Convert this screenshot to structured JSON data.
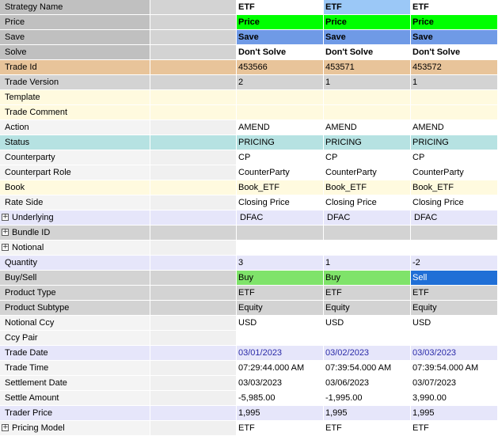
{
  "grid": {
    "rows": [
      {
        "label": "Strategy Name",
        "values": [
          "ETF",
          "ETF",
          "ETF"
        ],
        "style": "strategy"
      },
      {
        "label": "Price",
        "values": [
          "Price",
          "Price",
          "Price"
        ],
        "style": "price"
      },
      {
        "label": "Save",
        "values": [
          "Save",
          "Save",
          "Save"
        ],
        "style": "save"
      },
      {
        "label": "Solve",
        "values": [
          "Don't Solve",
          "Don't Solve",
          "Don't Solve"
        ],
        "style": "solve"
      },
      {
        "label": "Trade Id",
        "values": [
          "453566",
          "453571",
          "453572"
        ],
        "style": "tradeid"
      },
      {
        "label": "Trade Version",
        "values": [
          "2",
          "1",
          "1"
        ],
        "style": "version"
      },
      {
        "label": "Template",
        "values": [
          "",
          "",
          ""
        ],
        "style": "cream"
      },
      {
        "label": "Trade Comment",
        "values": [
          "",
          "",
          ""
        ],
        "style": "cream"
      },
      {
        "label": "Action",
        "values": [
          "AMEND",
          "AMEND",
          "AMEND"
        ],
        "style": "white"
      },
      {
        "label": "Status",
        "values": [
          "PRICING",
          "PRICING",
          "PRICING"
        ],
        "style": "status"
      },
      {
        "label": "Counterparty",
        "values": [
          "CP",
          "CP",
          "CP"
        ],
        "style": "white"
      },
      {
        "label": "Counterpart Role",
        "values": [
          "CounterParty",
          "CounterParty",
          "CounterParty"
        ],
        "style": "white"
      },
      {
        "label": "Book",
        "values": [
          "Book_ETF",
          "Book_ETF",
          "Book_ETF"
        ],
        "style": "cream"
      },
      {
        "label": "Rate Side",
        "values": [
          "Closing Price",
          "Closing Price",
          "Closing Price"
        ],
        "style": "white"
      },
      {
        "label": "Underlying",
        "values": [
          "DFAC",
          "DFAC",
          "DFAC"
        ],
        "style": "lavender",
        "expander": true,
        "indent": true
      },
      {
        "label": "Bundle ID",
        "values": [
          "",
          "",
          ""
        ],
        "style": "gray",
        "expander": true
      },
      {
        "label": "Notional",
        "values": [
          "",
          "",
          ""
        ],
        "style": "white",
        "expander": true
      },
      {
        "label": "Quantity",
        "values": [
          "3",
          "1",
          "-2"
        ],
        "style": "lavender"
      },
      {
        "label": "Buy/Sell",
        "values": [
          "Buy",
          "Buy",
          "Sell"
        ],
        "style": "buysell"
      },
      {
        "label": "Product Type",
        "values": [
          "ETF",
          "ETF",
          "ETF"
        ],
        "style": "gray"
      },
      {
        "label": "Product Subtype",
        "values": [
          "Equity",
          "Equity",
          "Equity"
        ],
        "style": "gray"
      },
      {
        "label": "Notional Ccy",
        "values": [
          "USD",
          "USD",
          "USD"
        ],
        "style": "white"
      },
      {
        "label": "Ccy Pair",
        "values": [
          "",
          "",
          ""
        ],
        "style": "white"
      },
      {
        "label": "Trade Date",
        "values": [
          "03/01/2023",
          "03/02/2023",
          "03/03/2023"
        ],
        "style": "date"
      },
      {
        "label": "Trade Time",
        "values": [
          "07:29:44.000 AM",
          "07:39:54.000 AM",
          "07:39:54.000 AM"
        ],
        "style": "white"
      },
      {
        "label": "Settlement Date",
        "values": [
          "03/03/2023",
          "03/06/2023",
          "03/07/2023"
        ],
        "style": "white"
      },
      {
        "label": "Settle Amount",
        "values": [
          "-5,985.00",
          "-1,995.00",
          "3,990.00"
        ],
        "style": "white"
      },
      {
        "label": "Trader Price",
        "values": [
          "1,995",
          "1,995",
          "1,995"
        ],
        "style": "lavender"
      },
      {
        "label": "Pricing Model",
        "values": [
          "ETF",
          "ETF",
          "ETF"
        ],
        "style": "white",
        "expander": true
      }
    ]
  },
  "colors": {
    "price_green": "#00ff00",
    "save_blue": "#6f9ae6",
    "trade_id_tan": "#e8c49a",
    "status_teal": "#b6e2e2",
    "cream": "#fffadf",
    "lavender": "#e6e6fa",
    "buy_green": "#7fe36a",
    "sell_blue": "#1f6fd6",
    "strategy_selected": "#9bc8f7"
  },
  "icons": {
    "expander": "plus-box-icon",
    "expander_glyph": "+"
  }
}
